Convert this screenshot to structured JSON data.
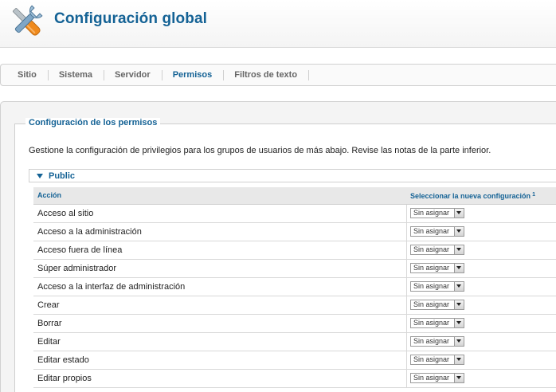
{
  "header": {
    "title": "Configuración global"
  },
  "tabs": [
    {
      "label": "Sitio",
      "active": false
    },
    {
      "label": "Sistema",
      "active": false
    },
    {
      "label": "Servidor",
      "active": false
    },
    {
      "label": "Permisos",
      "active": true
    },
    {
      "label": "Filtros de texto",
      "active": false
    }
  ],
  "permissions": {
    "legend": "Configuración de los permisos",
    "description": "Gestione la configuración de privilegios para los grupos de usuarios de más abajo. Revise las notas de la parte inferior.",
    "group": "Public",
    "columns": {
      "action": "Acción",
      "setting": "Seleccionar la nueva configuración",
      "setting_note": "1"
    },
    "rows": [
      {
        "action": "Acceso al sitio",
        "value": "Sin asignar"
      },
      {
        "action": "Acceso a la administración",
        "value": "Sin asignar"
      },
      {
        "action": "Acceso fuera de línea",
        "value": "Sin asignar"
      },
      {
        "action": "Súper administrador",
        "value": "Sin asignar"
      },
      {
        "action": "Acceso a la interfaz de administración",
        "value": "Sin asignar"
      },
      {
        "action": "Crear",
        "value": "Sin asignar"
      },
      {
        "action": "Borrar",
        "value": "Sin asignar"
      },
      {
        "action": "Editar",
        "value": "Sin asignar"
      },
      {
        "action": "Editar estado",
        "value": "Sin asignar"
      },
      {
        "action": "Editar propios",
        "value": "Sin asignar"
      }
    ]
  },
  "colors": {
    "accent": "#146295",
    "tab_inactive": "#666666"
  },
  "icons": {
    "logo": "tools-icon",
    "collapse": "triangle-down-icon",
    "dropdown": "chevron-down-icon"
  }
}
